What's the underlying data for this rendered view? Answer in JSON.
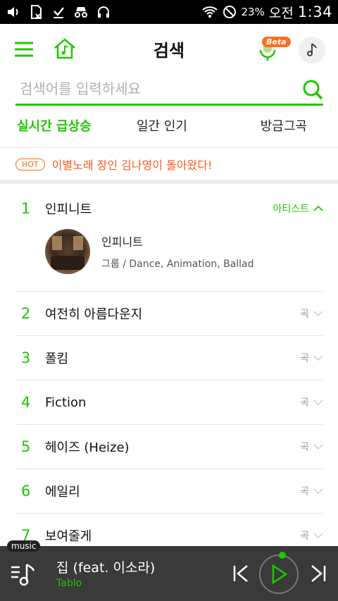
{
  "status_bar": {
    "battery": "23%",
    "ampm": "오전",
    "time": "1:34",
    "icons": [
      "volume-icon",
      "sim-icon",
      "download-icon",
      "incognito-icon",
      "headphones-icon",
      "wifi-icon",
      "blocked-icon"
    ]
  },
  "header": {
    "title": "검색",
    "beta_label": "Beta",
    "icons": [
      "menu-icon",
      "home-music-icon",
      "mic-icon",
      "music-note-icon"
    ]
  },
  "search": {
    "placeholder": "검색어를 입력하세요",
    "value": ""
  },
  "tabs": [
    {
      "label": "실시간 급상승",
      "active": true
    },
    {
      "label": "일간 인기",
      "active": false
    },
    {
      "label": "방금그곡",
      "active": false
    }
  ],
  "hot": {
    "badge": "HOT",
    "text": "이별노래 장인 김나영이 돌아왔다!"
  },
  "list": [
    {
      "rank": "1",
      "title": "인피니트",
      "type": "아티스트",
      "expanded": true,
      "artist": {
        "name": "인피니트",
        "meta": "그룹 / Dance, Animation, Ballad"
      }
    },
    {
      "rank": "2",
      "title": "여전히 아름다운지",
      "type": "곡"
    },
    {
      "rank": "3",
      "title": "폴킴",
      "type": "곡"
    },
    {
      "rank": "4",
      "title": "Fiction",
      "type": "곡"
    },
    {
      "rank": "5",
      "title": "헤이즈 (Heize)",
      "type": "곡"
    },
    {
      "rank": "6",
      "title": "에일리",
      "type": "곡"
    },
    {
      "rank": "7",
      "title": "보여줄게",
      "type": "곡"
    }
  ],
  "player": {
    "badge": "music",
    "title": "집 (feat. 이소라)",
    "artist": "Tablo"
  },
  "colors": {
    "accent": "#1ec800",
    "hot": "#ff5a1f",
    "player_bg": "#3a3a3a"
  }
}
